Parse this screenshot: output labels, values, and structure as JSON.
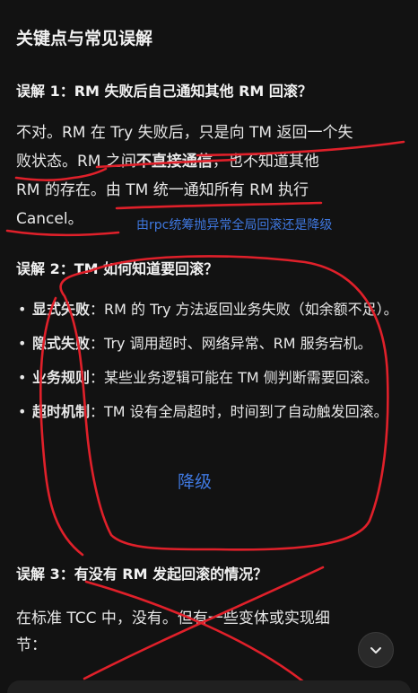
{
  "title": "关键点与常见误解",
  "sections": [
    {
      "heading": "误解 1：RM 失败后自己通知其他 RM 回滚？"
    },
    {
      "heading": "误解 2：TM 如何知道要回滚？"
    },
    {
      "heading": "误解 3：有没有 RM 发起回滚的情况？"
    }
  ],
  "para1": {
    "l1": "不对。RM 在 Try 失败后，只是向 TM 返回一个失",
    "l2a": "败状态。RM 之间",
    "l2b": "不直接通信",
    "l2c": "，也不知道其他",
    "l3": "RM 的存在。由 TM 统一通知所有 RM 执行",
    "l4": "Cancel。"
  },
  "bullets": [
    {
      "key": "显式失败",
      "text": "：RM 的 Try 方法返回业务失败（如余额不足）。"
    },
    {
      "key": "隐式失败",
      "text": "：Try 调用超时、网络异常、RM 服务宕机。"
    },
    {
      "key": "业务规则",
      "text": "：某些业务逻辑可能在 TM 侧判断需要回滚。"
    },
    {
      "key": "超时机制",
      "text": "：TM 设有全局超时，时间到了自动触发回滚。"
    }
  ],
  "para3": {
    "l1": "在标准 TCC 中，没有。但有一些变体或实现细",
    "l2": "节："
  },
  "annotations": {
    "blue_note": "由rpc统筹抛异常全局回滚还是降级",
    "jiangji": "降级"
  },
  "icons": {
    "scroll_down": "chevron-down-icon"
  },
  "colors": {
    "background": "#121212",
    "annotation_red": "#e0202a",
    "annotation_blue": "#3f78e0"
  }
}
